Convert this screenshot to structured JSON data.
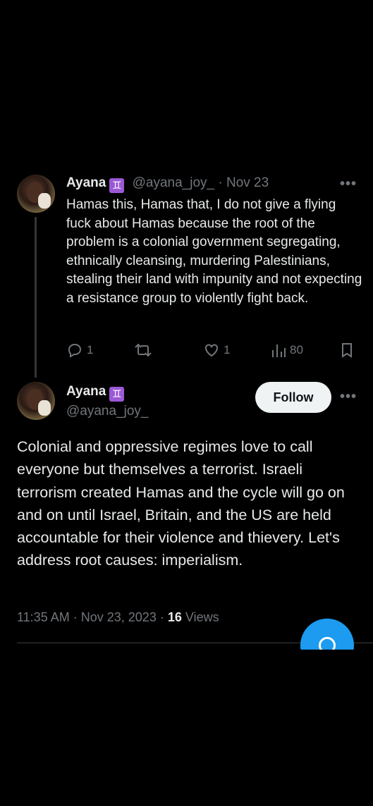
{
  "colors": {
    "background": "#000000",
    "text_primary": "#e7e9ea",
    "text_muted": "#71767b",
    "accent": "#1d9bf0",
    "follow_bg": "#eff3f4",
    "gemini_badge": "#9b59d6"
  },
  "tweet1": {
    "name": "Ayana",
    "badge": "♊",
    "handle": "@ayana_joy_",
    "separator": "·",
    "date": "Nov 23",
    "more": "•••",
    "text": "Hamas this, Hamas that, I do not give a flying fuck about Hamas because the root of the problem is a colonial government segregating, ethnically cleansing, murdering Palestinians, stealing their land with impunity and not expecting a resistance group to violently fight back.",
    "actions": {
      "reply_count": "1",
      "retweet_count": "",
      "like_count": "1",
      "views_count": "80"
    },
    "icons": [
      "reply-icon",
      "retweet-icon",
      "like-icon",
      "views-icon",
      "bookmark-icon"
    ]
  },
  "tweet2": {
    "name": "Ayana",
    "badge": "♊",
    "handle": "@ayana_joy_",
    "follow_label": "Follow",
    "more": "•••",
    "text": "Colonial and oppressive regimes love to call everyone but themselves a terrorist. Israeli terrorism created Hamas and the cycle will go on and on until Israel, Britain, and the US are held accountable for their violence and thievery. Let's address root causes: imperialism.",
    "time": "11:35 AM",
    "separator1": "·",
    "date": "Nov 23, 2023",
    "separator2": "·",
    "views_count": "16",
    "views_label": "Views"
  },
  "fab": {
    "icon": "compose-message-icon"
  }
}
